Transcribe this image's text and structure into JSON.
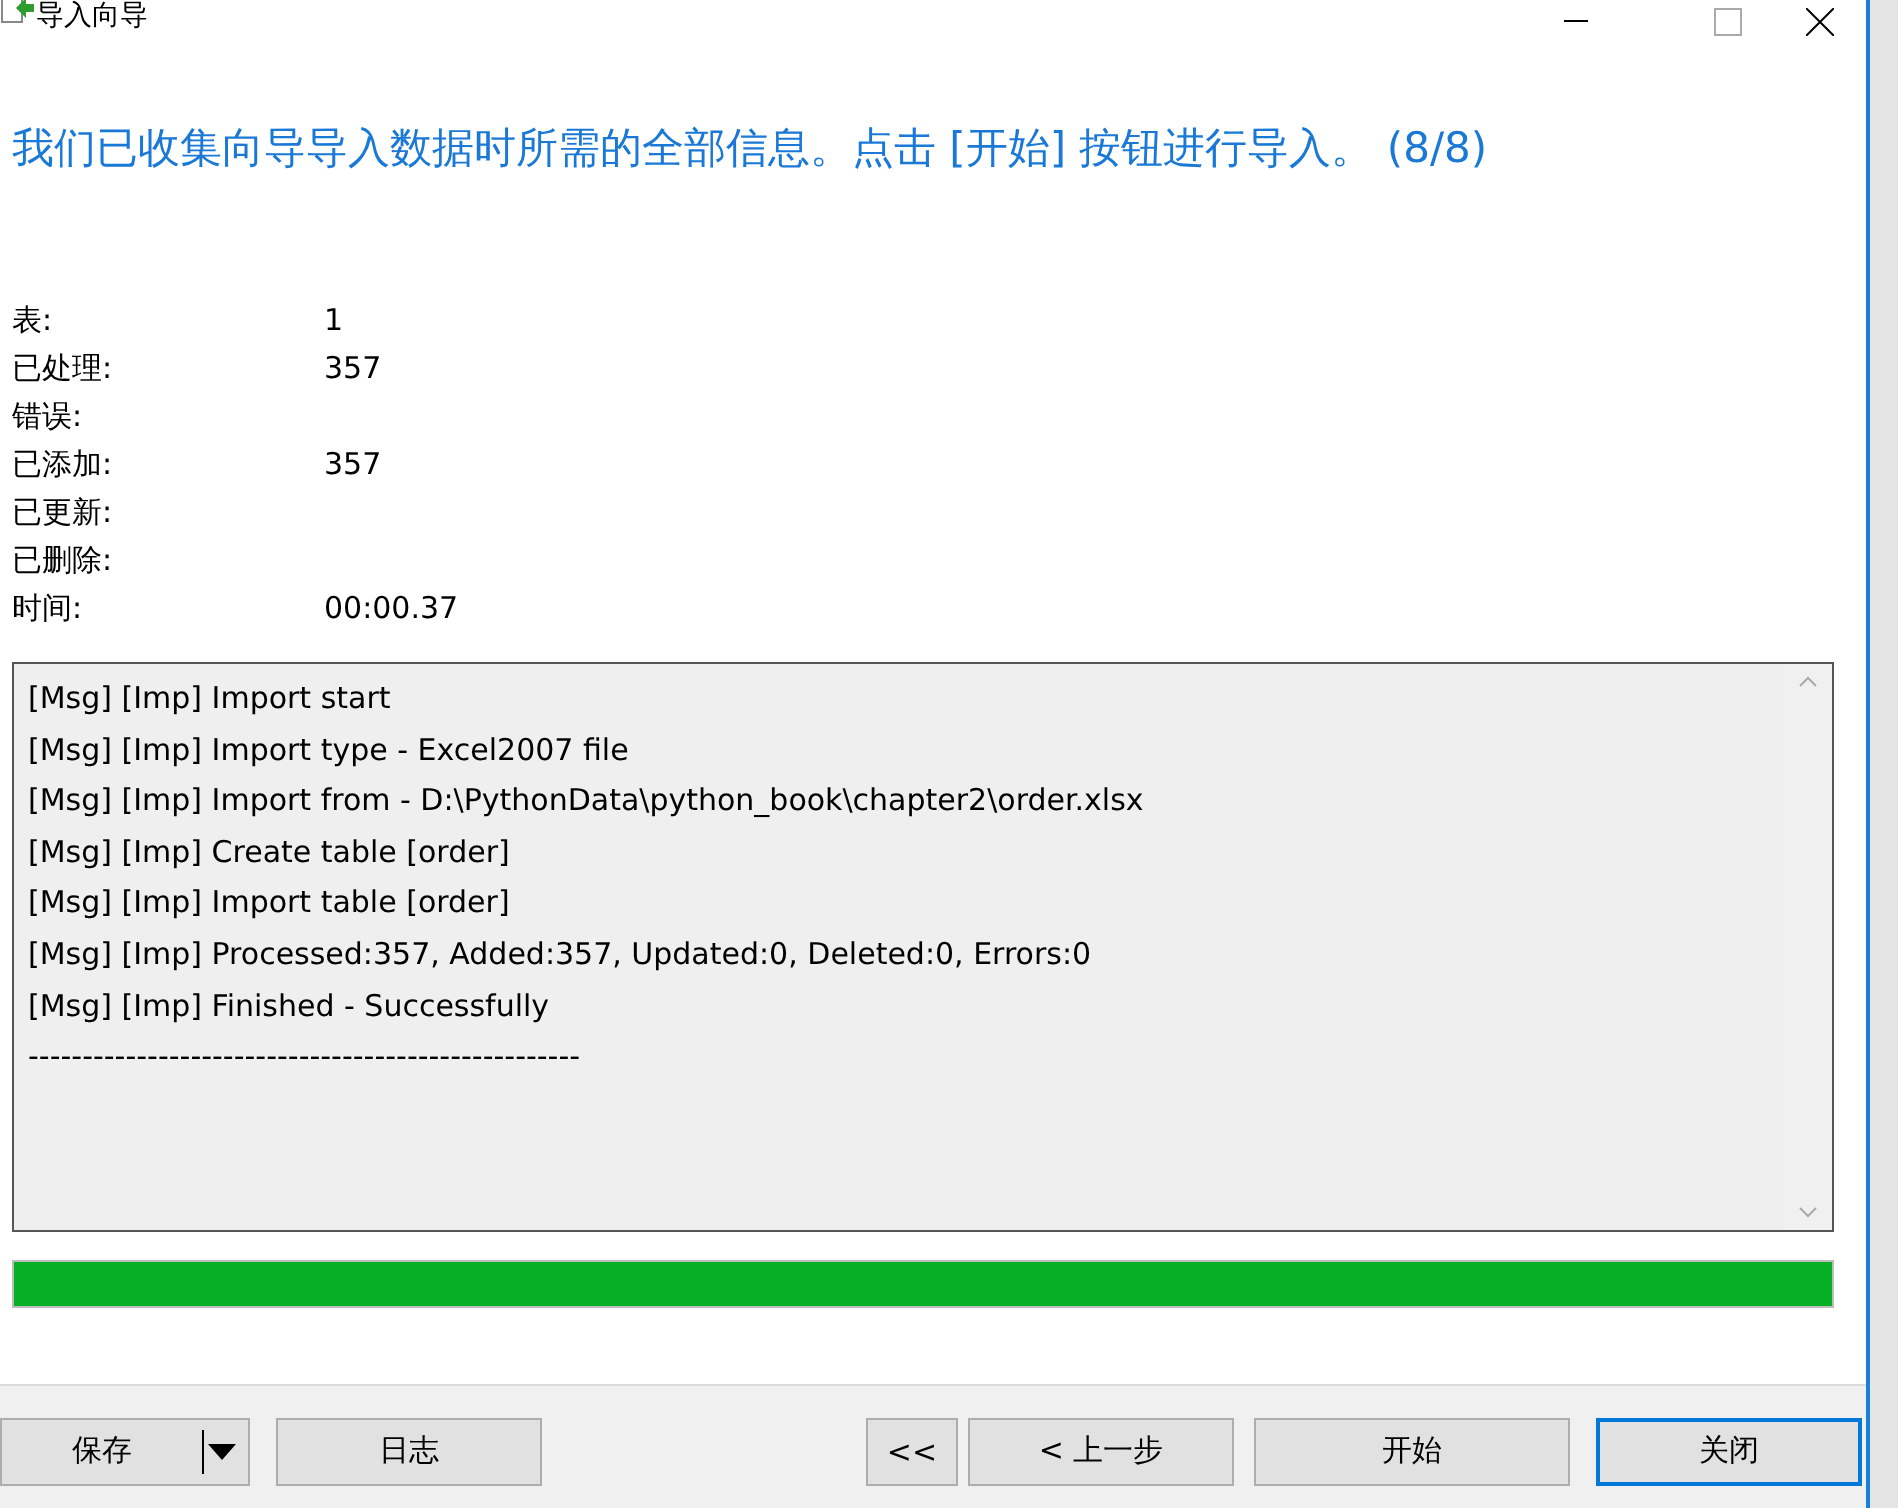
{
  "window": {
    "title": "导入向导"
  },
  "heading": "我们已收集向导导入数据时所需的全部信息。点击 [开始] 按钮进行导入。 (8/8)",
  "stats": [
    {
      "label": "表:",
      "value": "1"
    },
    {
      "label": "已处理:",
      "value": "357"
    },
    {
      "label": "错误:"
    },
    {
      "label": "已添加:",
      "value": "357"
    },
    {
      "label": "已更新:"
    },
    {
      "label": "已删除:"
    },
    {
      "label": "时间:",
      "value": "00:00.37"
    }
  ],
  "log": [
    "[Msg] [Imp] Import start",
    "[Msg] [Imp] Import type - Excel2007 file",
    "[Msg] [Imp] Import from - D:\\PythonData\\python_book\\chapter2\\order.xlsx",
    "[Msg] [Imp] Create table [order]",
    "[Msg] [Imp] Import table [order]",
    "[Msg] [Imp] Processed:357, Added:357, Updated:0, Deleted:0, Errors:0",
    "[Msg] [Imp] Finished - Successfully",
    "---------------------------------------------------"
  ],
  "progress": {
    "level": 1
  },
  "buttons": [
    {
      "label": "保存",
      "kind": "split",
      "default": false
    },
    {
      "label": "日志",
      "kind": "plain",
      "default": false
    },
    {
      "label": "<<",
      "kind": "small",
      "default": false
    },
    {
      "label": "< 上一步",
      "kind": "plain",
      "default": false
    },
    {
      "label": "开始",
      "kind": "wide",
      "default": false
    },
    {
      "label": "关闭",
      "kind": "plain",
      "default": true
    }
  ]
}
